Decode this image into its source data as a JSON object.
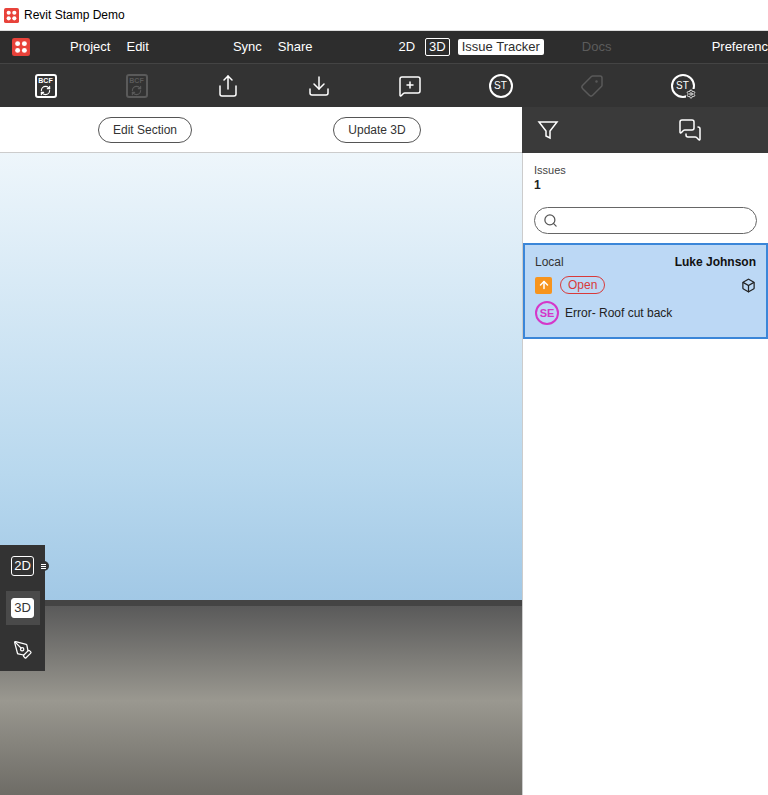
{
  "window": {
    "title": "Revit Stamp Demo"
  },
  "menu": [
    {
      "label": "Project"
    },
    {
      "label": "Edit"
    },
    {
      "label": "Sync"
    },
    {
      "label": "Share"
    }
  ],
  "mode_tabs": [
    {
      "label": "2D",
      "kind": "plain",
      "selected": false,
      "disabled": false
    },
    {
      "label": "3D",
      "kind": "boxed",
      "selected": false,
      "disabled": false
    },
    {
      "label": "Issue Tracker",
      "kind": "plain",
      "selected": true,
      "disabled": false
    },
    {
      "label": "Docs",
      "kind": "plain",
      "selected": false,
      "disabled": true
    }
  ],
  "menu_right": "Preferenc",
  "toolbar": [
    {
      "kind": "bcf-import",
      "label": "BCF",
      "disabled": false
    },
    {
      "kind": "bcf-export",
      "label": "BCF",
      "disabled": true
    },
    {
      "kind": "upload",
      "label": "",
      "disabled": false
    },
    {
      "kind": "download",
      "label": "",
      "disabled": false
    },
    {
      "kind": "add-comment",
      "label": "",
      "disabled": false
    },
    {
      "kind": "stamp",
      "label": "ST",
      "disabled": false
    },
    {
      "kind": "tag",
      "label": "",
      "disabled": true
    },
    {
      "kind": "stamp-settings",
      "label": "ST",
      "disabled": false
    }
  ],
  "view_buttons": [
    "Edit Section",
    "Update 3D"
  ],
  "side_tools": [
    {
      "kind": "view",
      "label": "2D",
      "selected": false
    },
    {
      "kind": "view",
      "label": "3D",
      "selected": true
    },
    {
      "kind": "pen",
      "label": "",
      "selected": false
    }
  ],
  "issues_panel": {
    "label": "Issues",
    "count": "1",
    "search": {
      "placeholder": ""
    }
  },
  "issues": [
    {
      "source": "Local",
      "author": "Luke Johnson",
      "status": "Open",
      "initials": "SE",
      "title": "Error- Roof cut back",
      "selected": true
    }
  ]
}
